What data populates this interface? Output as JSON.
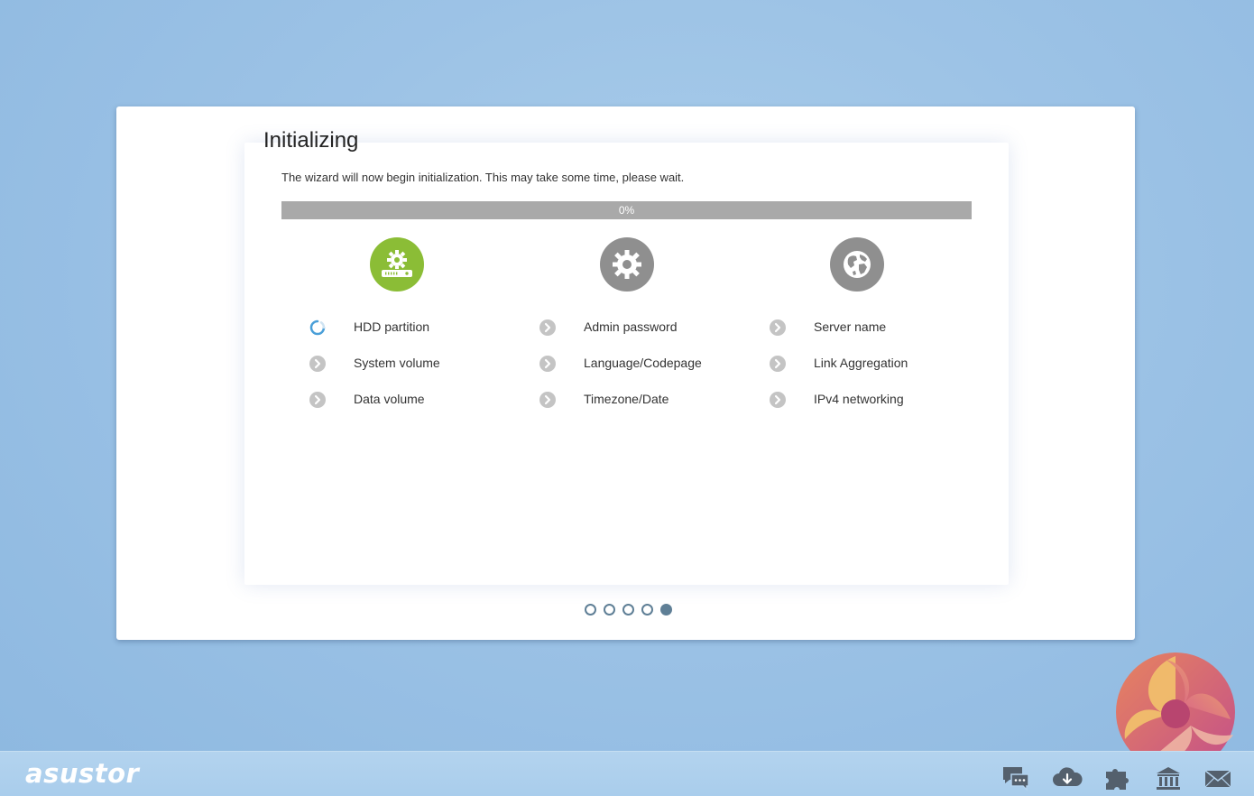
{
  "wizard": {
    "title": "Initializing",
    "description": "The wizard will now begin initialization. This may take some time, please wait.",
    "progress": {
      "value": 0,
      "label": "0%"
    },
    "stages": [
      {
        "icon": "hdd-gear-icon",
        "state": "active",
        "steps": [
          {
            "label": "HDD partition",
            "status": "in-progress"
          },
          {
            "label": "System volume",
            "status": "pending"
          },
          {
            "label": "Data volume",
            "status": "pending"
          }
        ]
      },
      {
        "icon": "gear-icon",
        "state": "pending",
        "steps": [
          {
            "label": "Admin password",
            "status": "pending"
          },
          {
            "label": "Language/Codepage",
            "status": "pending"
          },
          {
            "label": "Timezone/Date",
            "status": "pending"
          }
        ]
      },
      {
        "icon": "globe-icon",
        "state": "pending",
        "steps": [
          {
            "label": "Server name",
            "status": "pending"
          },
          {
            "label": "Link Aggregation",
            "status": "pending"
          },
          {
            "label": "IPv4 networking",
            "status": "pending"
          }
        ]
      }
    ],
    "pagination": {
      "total": 5,
      "current": 5
    }
  },
  "taskbar": {
    "logo": "asustor",
    "tray_icons": [
      "chat-icon",
      "cloud-download-icon",
      "plugin-icon",
      "bank-icon",
      "mail-icon"
    ]
  },
  "colors": {
    "accent_green": "#8bbd36",
    "pending_gray": "#8f8f8f",
    "progress_track": "#a9a9a9",
    "dot_blue": "#5f7f96",
    "background_blue": "#9dc3e6"
  }
}
